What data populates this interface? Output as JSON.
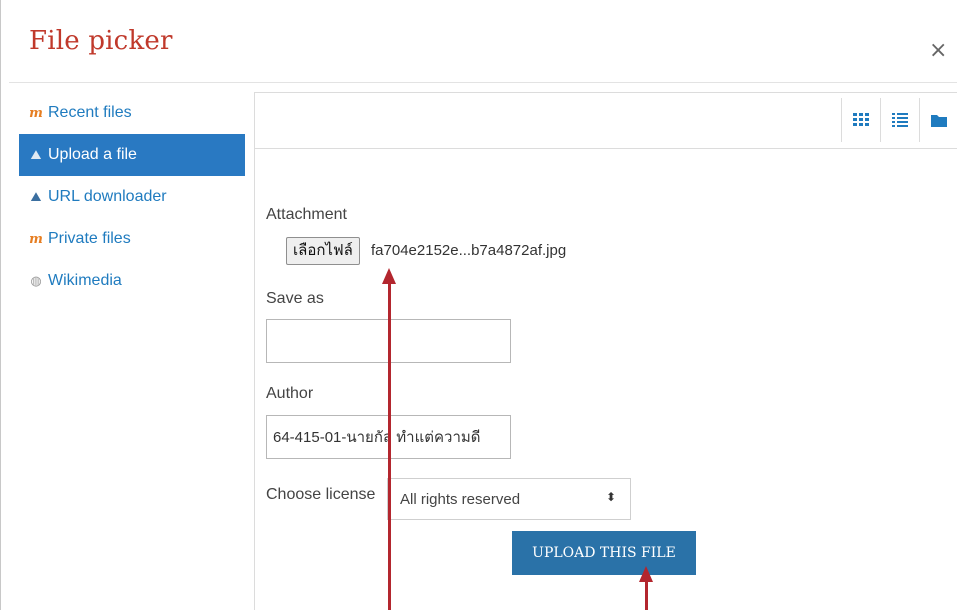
{
  "dialog": {
    "title": "File picker",
    "close_glyph": "×"
  },
  "sidebar": {
    "items": [
      {
        "label": "Recent files",
        "icon": "moodle-icon"
      },
      {
        "label": "Upload a file",
        "icon": "upload-icon",
        "active": true
      },
      {
        "label": "URL downloader",
        "icon": "url-icon"
      },
      {
        "label": "Private files",
        "icon": "moodle-icon"
      },
      {
        "label": "Wikimedia",
        "icon": "wikimedia-icon"
      }
    ]
  },
  "toolbar": {
    "views": [
      "grid-view-icon",
      "list-view-icon",
      "folder-view-icon"
    ]
  },
  "form": {
    "attachment_label": "Attachment",
    "choose_file_button": "เลือกไฟล์",
    "file_name": "fa704e2152e...b7a4872af.jpg",
    "save_as_label": "Save as",
    "save_as_value": "",
    "author_label": "Author",
    "author_value": "64-415-01-นายกัล ทำแต่ความดี",
    "license_label": "Choose license",
    "license_value": "All rights reserved",
    "upload_button": "UPLOAD THIS FILE"
  },
  "annotation_color": "#b3262e"
}
